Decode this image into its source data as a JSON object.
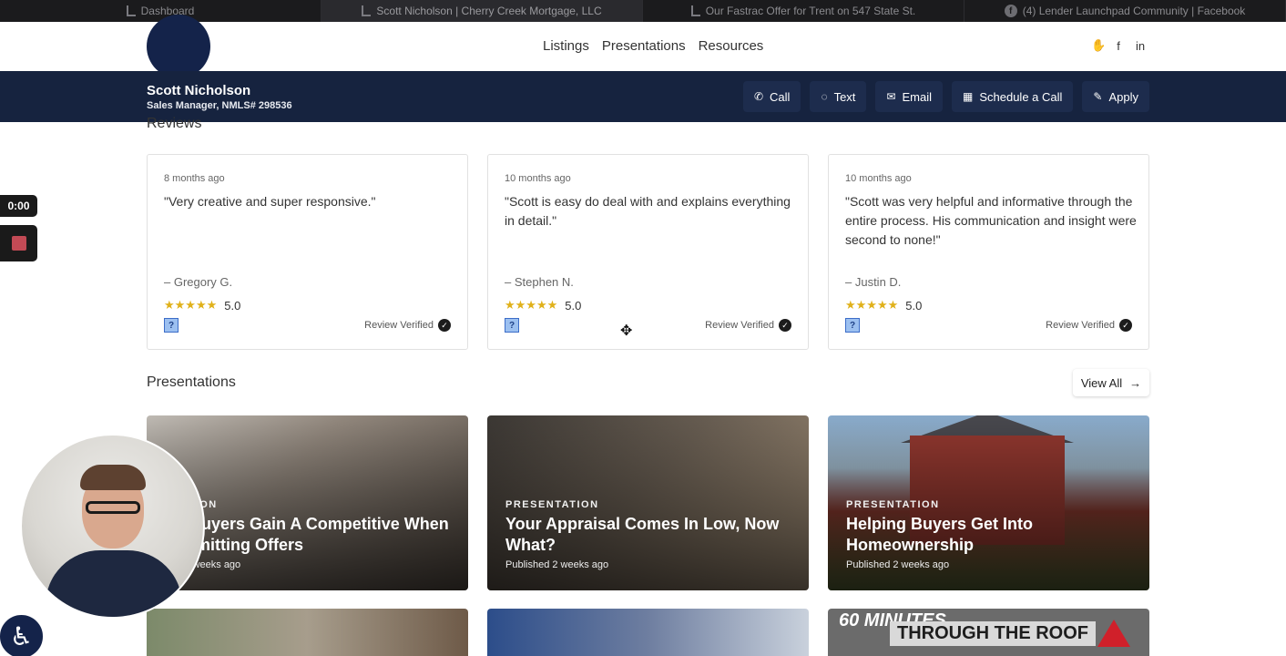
{
  "browser": {
    "tabs": [
      {
        "title": "Dashboard"
      },
      {
        "title": "Scott Nicholson | Cherry Creek Mortgage, LLC"
      },
      {
        "title": "Our Fastrac Offer for Trent on 547 State St."
      },
      {
        "title": "(4) Lender Launchpad Community | Facebook"
      }
    ]
  },
  "nav": {
    "links": [
      "Listings",
      "Presentations",
      "Resources"
    ],
    "social": [
      {
        "icon": "hand-icon",
        "glyph": "✋"
      },
      {
        "icon": "facebook-icon",
        "glyph": "f"
      },
      {
        "icon": "linkedin-icon",
        "glyph": "in"
      }
    ]
  },
  "agent": {
    "name": "Scott Nicholson",
    "title": "Sales Manager, NMLS# 298536",
    "actions": [
      {
        "label": "Call",
        "icon": "phone-icon",
        "glyph": "✆"
      },
      {
        "label": "Text",
        "icon": "chat-bubble-icon",
        "glyph": "◌"
      },
      {
        "label": "Email",
        "icon": "envelope-icon",
        "glyph": "✉"
      },
      {
        "label": "Schedule a Call",
        "icon": "calendar-icon",
        "glyph": "▦"
      },
      {
        "label": "Apply",
        "icon": "pencil-icon",
        "glyph": "✎"
      }
    ]
  },
  "reviews": {
    "section_title": "Reviews",
    "items": [
      {
        "time": "8 months ago",
        "quote": "\"Very creative and super responsive.\"",
        "author": "– Gregory G.",
        "stars": "★★★★★",
        "rating": "5.0",
        "verified": "Review Verified"
      },
      {
        "time": "10 months ago",
        "quote": "\"Scott is easy do deal with and explains everything in detail.\"",
        "author": "– Stephen N.",
        "stars": "★★★★★",
        "rating": "5.0",
        "verified": "Review Verified"
      },
      {
        "time": "10 months ago",
        "quote": "\"Scott was very helpful and informative through the entire process. His communication and insight were second to none!\"",
        "author": "– Justin D.",
        "stars": "★★★★★",
        "rating": "5.0",
        "verified": "Review Verified"
      }
    ]
  },
  "presentations": {
    "section_title": "Presentations",
    "view_all": "View All",
    "cards": [
      {
        "kicker": "NTATION",
        "title": "ng Buyers Gain A Competitive When Submitting Offers",
        "published": "hed 2 weeks ago"
      },
      {
        "kicker": "PRESENTATION",
        "title": "Your Appraisal Comes In Low, Now What?",
        "published": "Published 2 weeks ago"
      },
      {
        "kicker": "PRESENTATION",
        "title": "Helping Buyers Get Into Homeownership",
        "published": "Published 2 weeks ago"
      }
    ],
    "thumb_texts": {
      "minutes": "60 MINUTES",
      "roof": "THROUGH THE ROOF"
    }
  },
  "recorder": {
    "timer": "0:00"
  },
  "colors": {
    "navy": "#16233f",
    "star": "#e0b11a",
    "tabbar": "#1b1b1d"
  }
}
